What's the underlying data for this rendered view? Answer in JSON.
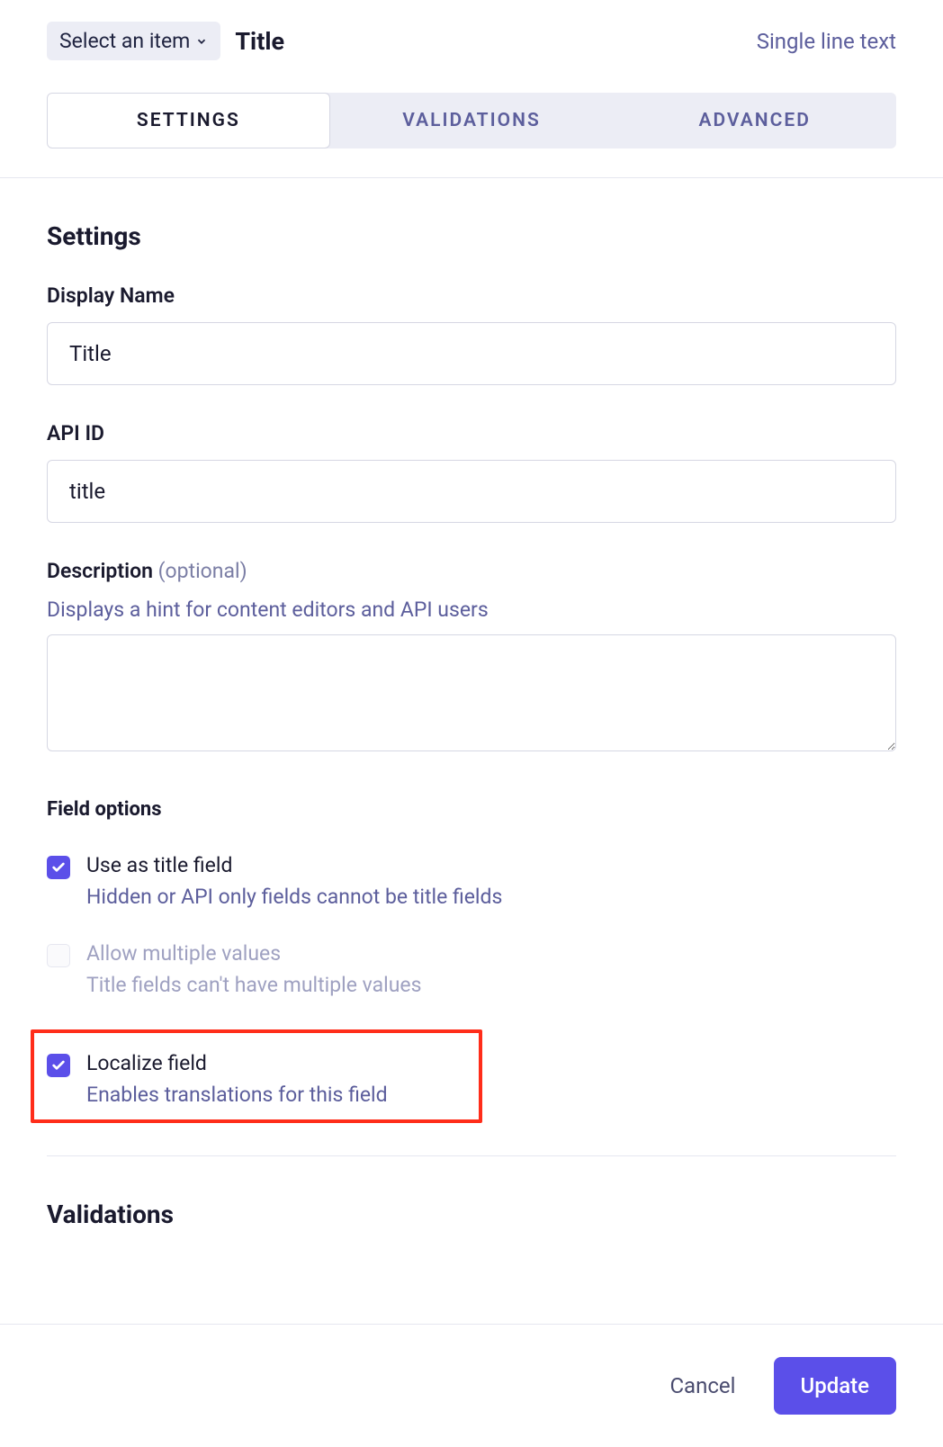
{
  "header": {
    "select_label": "Select an item",
    "title": "Title",
    "field_type": "Single line text"
  },
  "tabs": {
    "settings": "SETTINGS",
    "validations": "VALIDATIONS",
    "advanced": "ADVANCED"
  },
  "settings_section": {
    "heading": "Settings",
    "display_name_label": "Display Name",
    "display_name_value": "Title",
    "api_id_label": "API ID",
    "api_id_value": "title",
    "description_label": "Description",
    "description_optional": " (optional)",
    "description_hint": "Displays a hint for content editors and API users",
    "description_value": ""
  },
  "field_options": {
    "heading": "Field options",
    "title_field": {
      "label": "Use as title field",
      "hint": "Hidden or API only fields cannot be title fields",
      "checked": true
    },
    "multiple_values": {
      "label": "Allow multiple values",
      "hint": "Title fields can't have multiple values",
      "checked": false,
      "disabled": true
    },
    "localize": {
      "label": "Localize field",
      "hint": "Enables translations for this field",
      "checked": true
    }
  },
  "validations_section": {
    "heading": "Validations"
  },
  "footer": {
    "cancel": "Cancel",
    "update": "Update"
  }
}
